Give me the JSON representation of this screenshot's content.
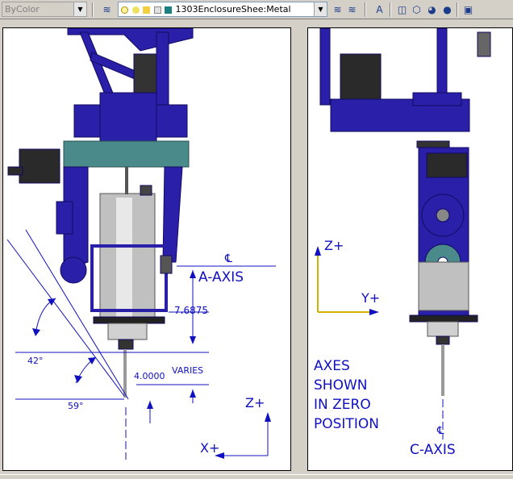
{
  "toolbar": {
    "color_combo": "ByColor",
    "layer_combo": "1303EnclosureShee:Metal",
    "layer_swatch_color": "#1a8080"
  },
  "left_view": {
    "a_axis_label": "A-AXIS",
    "centerline_symbol": "℄",
    "dim_upper": "7.6875",
    "dim_lower": "4.0000",
    "dim_varies": "VARIES",
    "angle_top": "42°",
    "angle_bottom": "59°",
    "z_label": "Z+",
    "x_label": "X+"
  },
  "right_view": {
    "z_label": "Z+",
    "y_label": "Y+",
    "note_lines": [
      "AXES",
      "SHOWN",
      "IN ZERO",
      "POSITION"
    ],
    "centerline_symbol": "℄",
    "c_axis_label": "C-AXIS"
  },
  "colors": {
    "machine_blue": "#2a1fa8",
    "dim_blue": "#1010c0",
    "axis_yellow": "#d4b000",
    "plate_teal": "#4b8a8a"
  }
}
